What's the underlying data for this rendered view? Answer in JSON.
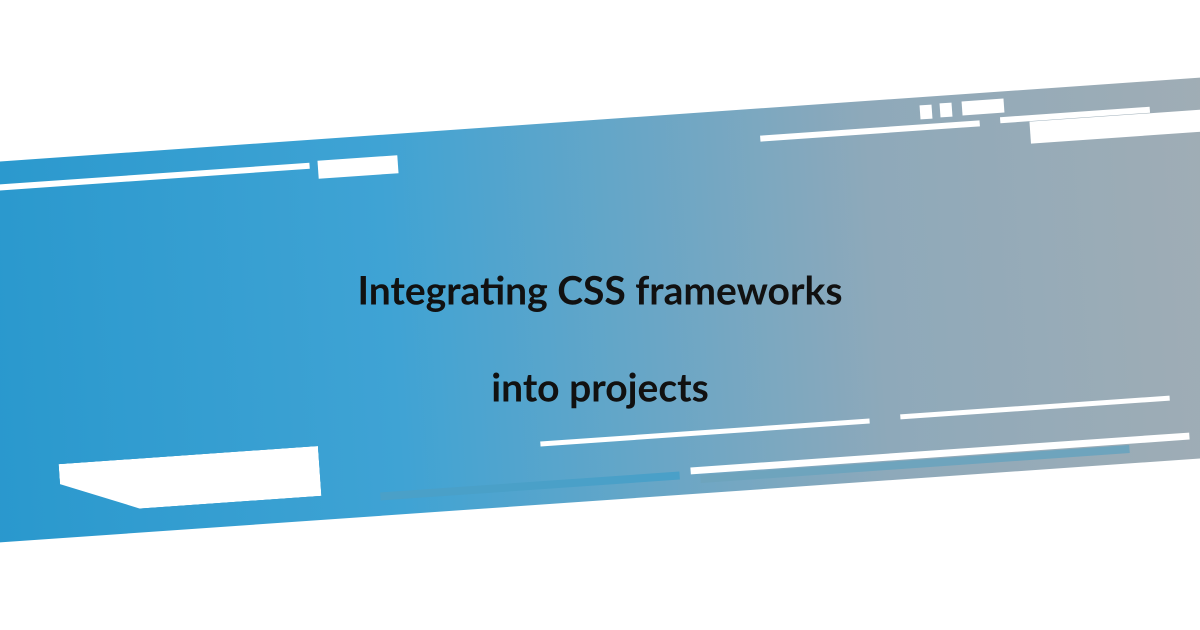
{
  "title": {
    "line1": "Integrating CSS frameworks",
    "line2": "into projects"
  },
  "colors": {
    "gradient_start": "#2596cc",
    "gradient_end": "#a4aeb4",
    "text": "#111111",
    "background": "#ffffff"
  }
}
